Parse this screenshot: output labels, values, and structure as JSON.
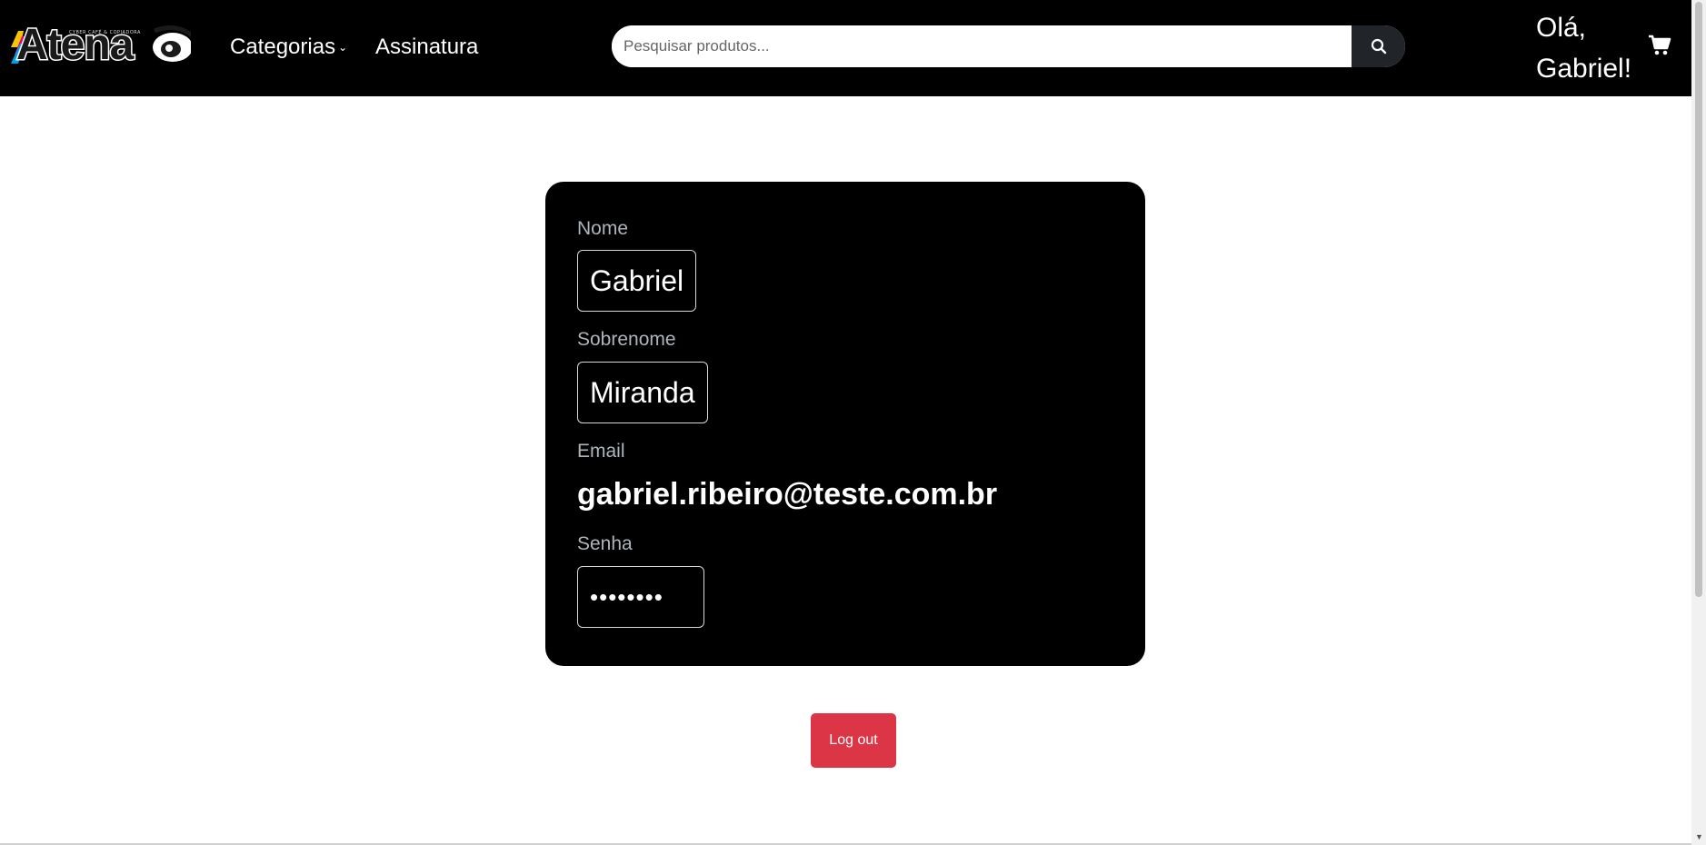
{
  "navbar": {
    "logo_text": "Atena",
    "logo_subtitle": "CYBER CAFÉ & COPIADORA",
    "categories_label": "Categorias",
    "subscription_label": "Assinatura",
    "search_placeholder": "Pesquisar produtos...",
    "greeting": "Olá, Gabriel!"
  },
  "profile": {
    "first_name_label": "Nome",
    "first_name_value": "Gabriel",
    "last_name_label": "Sobrenome",
    "last_name_value": "Miranda",
    "email_label": "Email",
    "email_value": "gabriel.ribeiro@teste.com.br",
    "password_label": "Senha",
    "password_mask": "••••••••"
  },
  "logout_label": "Log out",
  "icons": {
    "search": "search-icon",
    "cart": "cart-icon",
    "chevron": "chevron-down-icon"
  },
  "colors": {
    "navbar_bg": "#000000",
    "card_bg": "#000000",
    "logout_bg": "#dc3545",
    "search_btn_bg": "#212529",
    "label_color": "#aeb4bb"
  }
}
